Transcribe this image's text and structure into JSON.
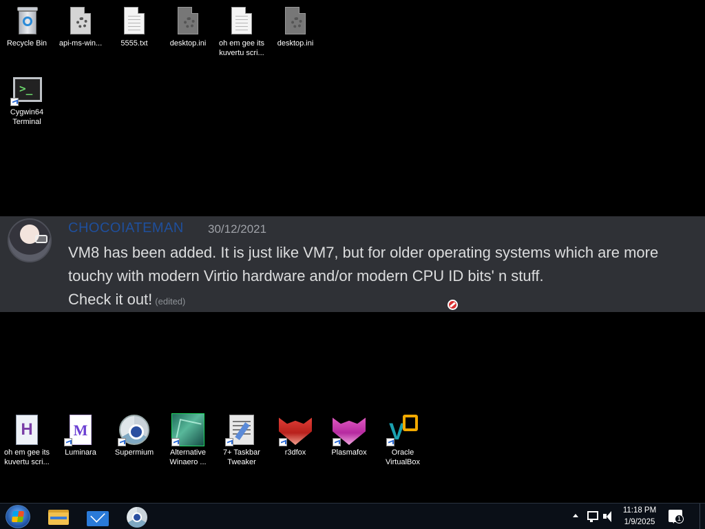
{
  "desktop": {
    "top_icons": [
      {
        "label": "Recycle Bin",
        "icon": "recycle-bin-icon"
      },
      {
        "label": "api-ms-win...",
        "icon": "system-file-icon"
      },
      {
        "label": "5555.txt",
        "icon": "text-file-icon"
      },
      {
        "label": "desktop.ini",
        "icon": "settings-file-icon"
      },
      {
        "label": "oh em gee its kuvertu scri...",
        "icon": "text-file-icon"
      },
      {
        "label": "desktop.ini",
        "icon": "settings-file-icon"
      }
    ],
    "cygwin": {
      "label": "Cygwin64 Terminal",
      "icon": "terminal-icon"
    },
    "bottom_icons": [
      {
        "label": "oh em gee its kuvertu scri...",
        "icon": "h-document-icon"
      },
      {
        "label": "Luminara",
        "icon": "luminara-icon"
      },
      {
        "label": "Supermium",
        "icon": "supermium-icon"
      },
      {
        "label": "Alternative Winaero ...",
        "icon": "winaero-icon"
      },
      {
        "label": "7+ Taskbar Tweaker",
        "icon": "taskbar-tweaker-icon"
      },
      {
        "label": "r3dfox",
        "icon": "r3dfox-icon"
      },
      {
        "label": "Plasmafox",
        "icon": "plasmafox-icon"
      },
      {
        "label": "Oracle VirtualBox",
        "icon": "virtualbox-icon"
      }
    ]
  },
  "message": {
    "username": "CHOCOIATEMAN",
    "timestamp": "30/12/2021",
    "line1": "VM8 has been added. It is just like VM7, but for older operating systems which are more",
    "line2": "touchy with modern Virtio hardware and/or modern CPU ID bits' n stuff.",
    "line3": "Check it out!",
    "edited": "(edited)",
    "username_color": "#1f4f9c",
    "background_color": "#2f3136"
  },
  "taskbar": {
    "pinned": [
      "start-button",
      "file-explorer",
      "mail",
      "supermium"
    ],
    "time": "11:18 PM",
    "date": "1/9/2025",
    "notification_count": "1"
  }
}
